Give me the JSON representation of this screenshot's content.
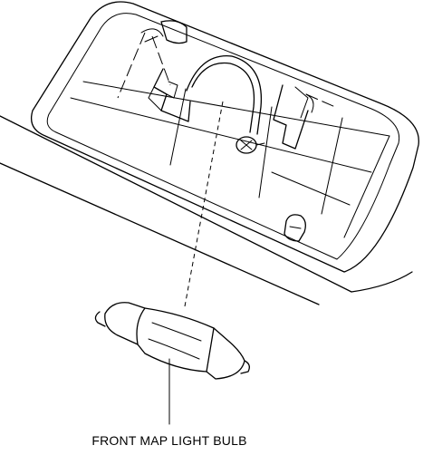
{
  "diagram": {
    "callout_label": "FRONT MAP LIGHT BULB",
    "ink_color": "#000000",
    "background_color": "#ffffff"
  }
}
